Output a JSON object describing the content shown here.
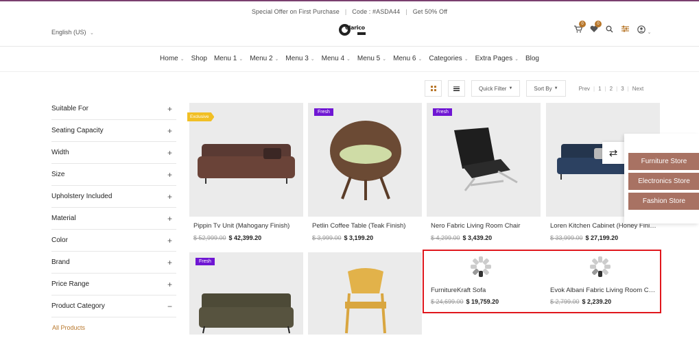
{
  "offer_bar": {
    "text1": "Special Offer on First Purchase",
    "text2": "Code : #ASDA44",
    "text3": "Get 50% Off"
  },
  "header": {
    "language": "English (US)",
    "logo_text": "Clarico",
    "cart_count": "0",
    "wishlist_count": "0"
  },
  "nav": [
    "Home",
    "Shop",
    "Menu 1",
    "Menu 2",
    "Menu 3",
    "Menu 4",
    "Menu 5",
    "Menu 6",
    "Categories",
    "Extra Pages",
    "Blog"
  ],
  "toolbar": {
    "quick_filter": "Quick Filter",
    "sort_by": "Sort By",
    "pager": {
      "prev": "Prev",
      "p1": "1",
      "p2": "2",
      "p3": "3",
      "next": "Next"
    }
  },
  "filters": [
    {
      "label": "Suitable For",
      "sign": "+"
    },
    {
      "label": "Seating Capacity",
      "sign": "+"
    },
    {
      "label": "Width",
      "sign": "+"
    },
    {
      "label": "Size",
      "sign": "+"
    },
    {
      "label": "Upholstery Included",
      "sign": "+"
    },
    {
      "label": "Material",
      "sign": "+"
    },
    {
      "label": "Color",
      "sign": "+"
    },
    {
      "label": "Brand",
      "sign": "+"
    },
    {
      "label": "Price Range",
      "sign": "+"
    },
    {
      "label": "Product Category",
      "sign": "−"
    }
  ],
  "all_products": "All Products",
  "products": [
    {
      "title": "Pippin Tv Unit (Mahogany Finish)",
      "old_price": "$ 52,999.00",
      "new_price": "$ 42,399.20",
      "tag": "Exclusive"
    },
    {
      "title": "Petlin Coffee Table (Teak Finish)",
      "old_price": "$ 3,999.00",
      "new_price": "$ 3,199.20",
      "tag": "Fresh"
    },
    {
      "title": "Nero Fabric Living Room Chair",
      "old_price": "$ 4,299.00",
      "new_price": "$ 3,439.20",
      "tag": "Fresh"
    },
    {
      "title": "Loren Kitchen Cabinet (Honey Finish)",
      "old_price": "$ 33,999.00",
      "new_price": "$ 27,199.20",
      "tag": ""
    },
    {
      "title": "",
      "old_price": "",
      "new_price": "",
      "tag": "Fresh"
    },
    {
      "title": "",
      "old_price": "",
      "new_price": "",
      "tag": ""
    },
    {
      "title": "FurnitureKraft Sofa",
      "old_price": "$ 24,699.00",
      "new_price": "$ 19,759.20",
      "tag": ""
    },
    {
      "title": "Evok Albani Fabric Living Room Chair",
      "old_price": "$ 2,799.00",
      "new_price": "$ 2,239.20",
      "tag": ""
    }
  ],
  "stores": [
    "Furniture Store",
    "Electronics Store",
    "Fashion Store"
  ],
  "colors": {
    "accent": "#b8772b",
    "fresh_tag": "#6f16d3",
    "exclusive_tag": "#f1bf25",
    "store_button": "#a87263",
    "highlight": "#e0161c"
  }
}
